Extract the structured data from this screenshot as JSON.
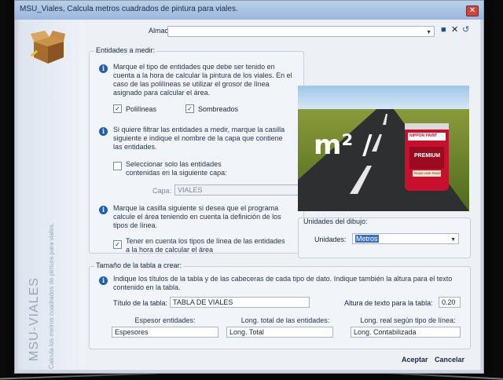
{
  "window": {
    "title": "MSU_Viales, Calcula metros cuadrados de pintura para viales."
  },
  "sidebar": {
    "title": "MSU-VIALES",
    "description": "Calcula los metros cuadrados de pintura para viales."
  },
  "almacen": {
    "label": "Almacén",
    "value": ""
  },
  "entidades": {
    "group_title": "Entidades a medir:",
    "info1": "Marque el tipo de entidades que debe ser tenido en cuenta a la hora de calcular la pintura de los viales. En el caso de las polilíneas se utilizar el grosor de línea asignado para calcular el área.",
    "polilineas": {
      "label": "Polilíneas",
      "checked": true
    },
    "sombreados": {
      "label": "Sombreados",
      "checked": true
    },
    "info2": "Si quiere filtrar las entidades a medir, marque la casilla siguiente e indique el nombre de la capa que contiene las entidades.",
    "filter_checkbox": {
      "label": "Seleccionar solo las entidades contenidas en la siguiente capa:",
      "checked": false
    },
    "capa": {
      "label": "Capa:",
      "value": "VIALES"
    },
    "info3": "Marque la casilla siguiente si desea que el programa calcule el área teniendo en cuenta la definición de los tipos de línea.",
    "linetype_checkbox": {
      "label": "Tener en cuenta los tipos de línea de las entidades a la hora de calcular el área",
      "checked": true
    }
  },
  "image": {
    "text": "m² /",
    "can_brand": "NIPPON PAINT",
    "can_label": "PREMIUM",
    "can_sub": "ROAD LINE PAINT"
  },
  "unidades": {
    "group_title": "Unidades del dibujo:",
    "label": "Unidades:",
    "value": "Metros"
  },
  "tabla": {
    "group_title": "Tamaño de la tabla a crear:",
    "info": "Indique los títulos de la tabla y de las cabeceras de cada tipo de dato. Indique también la altura para el texto contenido en la tabla.",
    "titulo_label": "Título de la tabla:",
    "titulo_value": "TABLA DE VIALES",
    "altura_label": "Altura de texto para la tabla:",
    "altura_value": "0.20",
    "headers": [
      "Espesor entidades:",
      "Long. total de las entidades:",
      "Long. real según tipo de línea:"
    ],
    "values": [
      "Espesores",
      "Long. Total",
      "Long. Contabilizada"
    ]
  },
  "buttons": {
    "accept": "Aceptar",
    "cancel": "Cancelar"
  },
  "colors": {
    "accent": "#1f5fb0",
    "window_bg": "#edf1f6",
    "selection": "#3b6fc4"
  }
}
